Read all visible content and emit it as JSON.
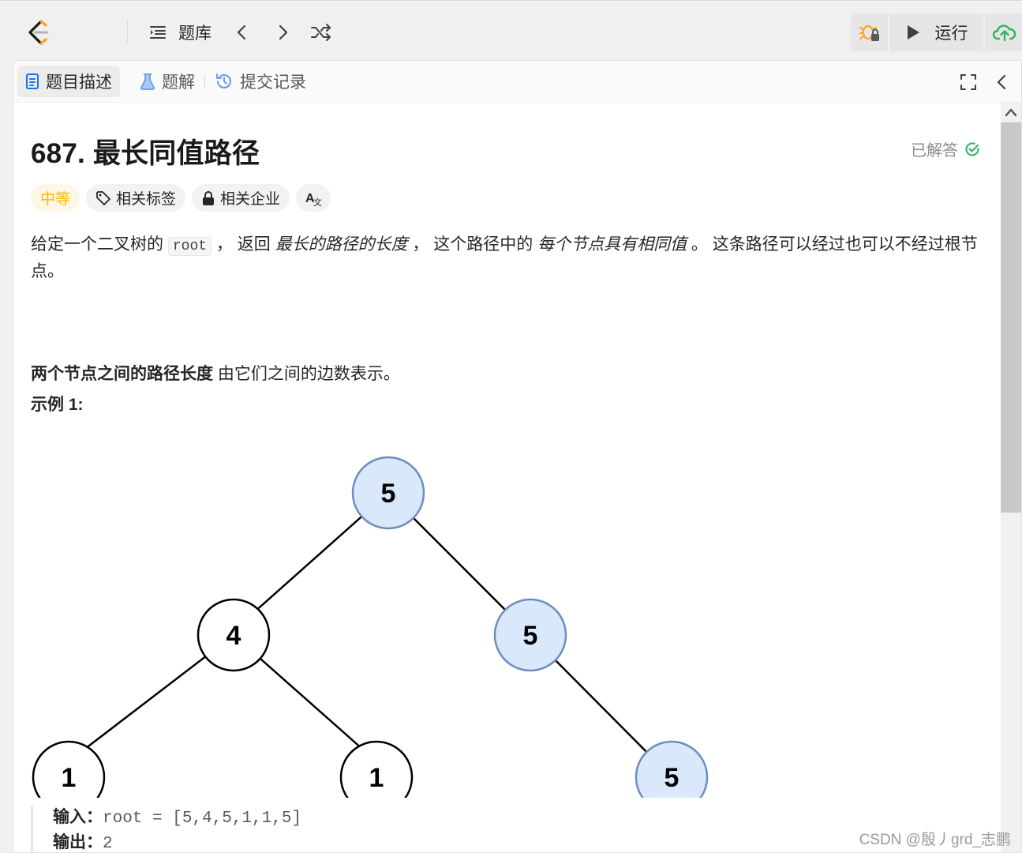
{
  "nav": {
    "problem_list_label": "题库",
    "run_label": "运行"
  },
  "tabs": {
    "description": "题目描述",
    "solution": "题解",
    "submissions": "提交记录"
  },
  "problem": {
    "title": "687. 最长同值路径",
    "status": "已解答",
    "difficulty": "中等",
    "tag_topics": "相关标签",
    "tag_companies": "相关企业",
    "tag_translate": "A文",
    "desc_p1_a": "给定一个二叉树的 ",
    "desc_p1_code": "root",
    "desc_p1_b": " ， 返回 ",
    "desc_p1_em1": "最长的路径的长度",
    "desc_p1_c": " ， 这个路径中的 ",
    "desc_p1_em2": "每个节点具有相同值",
    "desc_p1_d": " 。 这条路径可以经过也可以不经过根节点。",
    "desc_p2_bold": "两个节点之间的路径长度",
    "desc_p2_rest": " 由它们之间的边数表示。",
    "example_heading": "示例 1:",
    "input_label": "输入：",
    "input_value": "root = [5,4,5,1,1,5]",
    "output_label": "输出：",
    "output_value": "2"
  },
  "tree": {
    "nodes": [
      "5",
      "4",
      "5",
      "1",
      "1",
      "5"
    ],
    "highlight_fill": "#dae8fc",
    "highlight_stroke": "#6c8ebf"
  },
  "watermark": "CSDN @殷丿grd_志鹏"
}
